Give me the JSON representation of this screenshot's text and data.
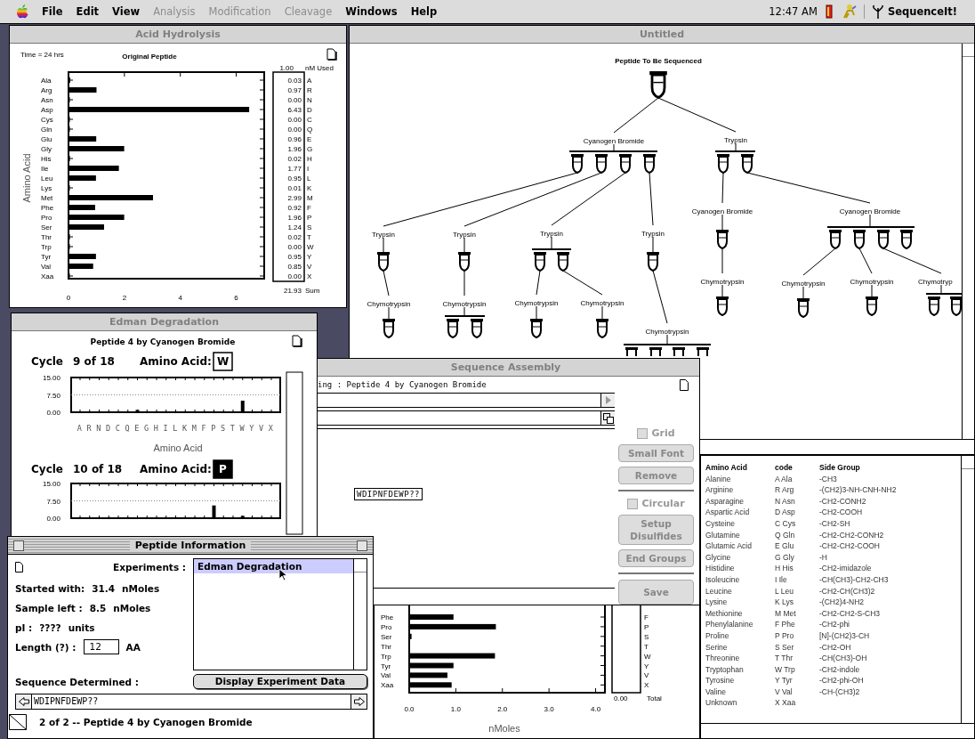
{
  "menu_bar": {
    "items": [
      {
        "label": "File",
        "disabled": false
      },
      {
        "label": "Edit",
        "disabled": false
      },
      {
        "label": "View",
        "disabled": false
      },
      {
        "label": "Analysis",
        "disabled": true
      },
      {
        "label": "Modification",
        "disabled": true
      },
      {
        "label": "Cleavage",
        "disabled": true
      },
      {
        "label": "Windows",
        "disabled": false
      },
      {
        "label": "Help",
        "disabled": false
      }
    ],
    "clock": "12:47 AM",
    "app": "SequenceIt!"
  },
  "acid_hydrolysis": {
    "title": "Acid Hydrolysis",
    "time": "Time = 24 hrs",
    "used_amount": "1.00",
    "used_label": "nM Used",
    "amounts": [
      {
        "value": "0.03",
        "code": "A"
      },
      {
        "value": "0.97",
        "code": "R"
      },
      {
        "value": "0.00",
        "code": "N"
      },
      {
        "value": "6.43",
        "code": "D"
      },
      {
        "value": "0.00",
        "code": "C"
      },
      {
        "value": "0.00",
        "code": "Q"
      },
      {
        "value": "0.96",
        "code": "E"
      },
      {
        "value": "1.96",
        "code": "G"
      },
      {
        "value": "0.02",
        "code": "H"
      },
      {
        "value": "1.77",
        "code": "I"
      },
      {
        "value": "0.95",
        "code": "L"
      },
      {
        "value": "0.01",
        "code": "K"
      },
      {
        "value": "2.99",
        "code": "M"
      },
      {
        "value": "0.92",
        "code": "F"
      },
      {
        "value": "1.96",
        "code": "P"
      },
      {
        "value": "1.24",
        "code": "S"
      },
      {
        "value": "0.02",
        "code": "T"
      },
      {
        "value": "0.00",
        "code": "W"
      },
      {
        "value": "0.95",
        "code": "Y"
      },
      {
        "value": "0.85",
        "code": "V"
      },
      {
        "value": "0.00",
        "code": "X"
      }
    ],
    "total": "21.93",
    "total_label": "Sum",
    "chart_data": {
      "type": "bar",
      "orientation": "horizontal",
      "title": "Original Peptide",
      "ylabel": "Amino Acid",
      "categories": [
        "Ala",
        "Arg",
        "Asn",
        "Asp",
        "Cys",
        "Gln",
        "Glu",
        "Gly",
        "His",
        "Ile",
        "Leu",
        "Lys",
        "Met",
        "Phe",
        "Pro",
        "Ser",
        "Thr",
        "Trp",
        "Tyr",
        "Val",
        "Xaa"
      ],
      "values": [
        0.03,
        0.97,
        0,
        6.43,
        0,
        0,
        0.96,
        1.96,
        0.02,
        1.77,
        0.95,
        0.01,
        2.99,
        0.92,
        1.96,
        1.24,
        0.02,
        0,
        0.95,
        0.85,
        0
      ],
      "xlim": [
        0,
        7
      ],
      "xticks": [
        0,
        2,
        4,
        6
      ]
    }
  },
  "untitled": {
    "title": "Untitled",
    "tree": {
      "label": "Peptide To Be Sequenced",
      "fragments": [
        {
          "kind": "tube",
          "treatments": [
            {
              "label": "Cyanogen Bromide",
              "fragments": [
                {
                  "kind": "tube",
                  "treatments": [
                    {
                      "label": "Trypsin",
                      "fragments": [
                        {
                          "kind": "tube",
                          "treatments": [
                            {
                              "label": "Chymotrypsin",
                              "fragments": [
                                {
                                  "kind": "tube"
                                }
                              ]
                            }
                          ]
                        }
                      ]
                    }
                  ]
                },
                {
                  "kind": "tube",
                  "treatments": [
                    {
                      "label": "Trypsin",
                      "fragments": [
                        {
                          "kind": "tube",
                          "treatments": [
                            {
                              "label": "Chymotrypsin",
                              "fragments": [
                                {
                                  "kind": "tube"
                                },
                                {
                                  "kind": "tube"
                                }
                              ]
                            }
                          ]
                        }
                      ]
                    }
                  ]
                },
                {
                  "kind": "tube",
                  "treatments": [
                    {
                      "label": "Trypsin",
                      "fragments": [
                        {
                          "kind": "tube",
                          "treatments": [
                            {
                              "label": "Chymotrypsin",
                              "fragments": [
                                {
                                  "kind": "tube"
                                }
                              ]
                            }
                          ]
                        },
                        {
                          "kind": "tube",
                          "treatments": [
                            {
                              "label": "Chymotrypsin",
                              "fragments": [
                                {
                                  "kind": "tube"
                                }
                              ]
                            }
                          ]
                        }
                      ]
                    }
                  ]
                },
                {
                  "kind": "tube",
                  "treatments": [
                    {
                      "label": "Trypsin",
                      "fragments": [
                        {
                          "kind": "tube",
                          "treatments": [
                            {
                              "label": "Chymotrypsin",
                              "fragments": [
                                {
                                  "kind": "tube"
                                },
                                {
                                  "kind": "tube"
                                },
                                {
                                  "kind": "tube"
                                },
                                {
                                  "kind": "tube"
                                }
                              ]
                            }
                          ]
                        }
                      ]
                    }
                  ]
                }
              ]
            },
            {
              "label": "Trypsin",
              "fragments": [
                {
                  "kind": "tube",
                  "treatments": [
                    {
                      "label": "Cyanogen Bromide",
                      "fragments": [
                        {
                          "kind": "tube",
                          "treatments": [
                            {
                              "label": "Chymotrypsin",
                              "fragments": [
                                {
                                  "kind": "tube"
                                }
                              ]
                            }
                          ]
                        }
                      ]
                    }
                  ]
                },
                {
                  "kind": "tube",
                  "treatments": [
                    {
                      "label": "Cyanogen Bromide",
                      "fragments": [
                        {
                          "kind": "tube",
                          "treatments": [
                            {
                              "label": "Chymotrypsin",
                              "fragments": [
                                {
                                  "kind": "tube"
                                }
                              ]
                            }
                          ]
                        },
                        {
                          "kind": "tube",
                          "treatments": [
                            {
                              "label": "Chymotrypsin",
                              "fragments": [
                                {
                                  "kind": "tube"
                                }
                              ]
                            }
                          ]
                        },
                        {
                          "kind": "tube",
                          "treatments": [
                            {
                              "label": "Chymotryp",
                              "fragments": [
                                {
                                  "kind": "tube"
                                },
                                {
                                  "kind": "tube"
                                }
                              ]
                            }
                          ]
                        },
                        {
                          "kind": "tube"
                        }
                      ]
                    }
                  ]
                }
              ]
            }
          ]
        }
      ]
    }
  },
  "amino_acid_table": {
    "columns": [
      "Amino Acid",
      "code",
      "Side Group"
    ],
    "rows": [
      [
        "Alanine",
        "A Ala",
        "-CH3"
      ],
      [
        "Arginine",
        "R Arg",
        "-(CH2)3-NH-CNH-NH2"
      ],
      [
        "Asparagine",
        "N Asn",
        "-CH2-CONH2"
      ],
      [
        "Aspartic Acid",
        "D Asp",
        "-CH2-COOH"
      ],
      [
        "Cysteine",
        "C Cys",
        "-CH2-SH"
      ],
      [
        "Glutamine",
        "Q Gln",
        "-CH2-CH2-CONH2"
      ],
      [
        "Glutamic Acid",
        "E Glu",
        "-CH2-CH2-COOH"
      ],
      [
        "Glycine",
        "G Gly",
        "-H"
      ],
      [
        "Histidine",
        "H His",
        "-CH2-imidazole"
      ],
      [
        "Isoleucine",
        "I Ile",
        "-CH(CH3)-CH2-CH3"
      ],
      [
        "Leucine",
        "L Leu",
        "-CH2-CH(CH3)2"
      ],
      [
        "Lysine",
        "K Lys",
        "-(CH2)4-NH2"
      ],
      [
        "Methionine",
        "M Met",
        "-CH2-CH2-S-CH3"
      ],
      [
        "Phenylalanine",
        "F Phe",
        "-CH2-phi"
      ],
      [
        "Proline",
        "P Pro",
        "[N]-(CH2)3-CH"
      ],
      [
        "Serine",
        "S Ser",
        "-CH2-OH"
      ],
      [
        "Threonine",
        "T Thr",
        "-CH(CH3)-OH"
      ],
      [
        "Tryptophan",
        "W Trp",
        "-CH2-indole"
      ],
      [
        "Tyrosine",
        "Y Tyr",
        "-CH2-phi-OH"
      ],
      [
        "Valine",
        "V Val",
        "-CH-(CH3)2"
      ],
      [
        "Unknown",
        "X Xaa"
      ]
    ]
  },
  "nmoles_chart": {
    "codes": [
      "F",
      "P",
      "S",
      "T",
      "W",
      "Y",
      "V",
      "X"
    ],
    "total": "0.00",
    "total_label": "Total",
    "chart_data": {
      "type": "bar",
      "orientation": "horizontal",
      "xlabel": "nMoles",
      "categories": [
        "Phe",
        "Pro",
        "Ser",
        "Thr",
        "Trp",
        "Tyr",
        "Val",
        "Xaa"
      ],
      "values": [
        0.95,
        1.86,
        0.05,
        0,
        1.84,
        0.95,
        0.82,
        0.91
      ],
      "xlim": [
        0,
        4.2
      ],
      "xticks": [
        {
          "value": 0,
          "label": "0.0"
        },
        {
          "value": 1,
          "label": "1.0"
        },
        {
          "value": 2,
          "label": "2.0"
        },
        {
          "value": 3,
          "label": "3.0"
        },
        {
          "value": 4,
          "label": "4.0"
        }
      ]
    }
  },
  "sequence_assembly": {
    "title": "Sequence Assembly",
    "header": "ing : Peptide 4 by Cyanogen Bromide",
    "fragment": "WDIPNFDEWP??",
    "controls": [
      {
        "kind": "checkbox",
        "label": "Grid",
        "checked": false
      },
      {
        "kind": "button",
        "label": "Small Font"
      },
      {
        "kind": "button",
        "label": "Remove"
      },
      {
        "kind": "divider"
      },
      {
        "kind": "checkbox",
        "label": "Circular",
        "checked": false
      },
      {
        "kind": "button",
        "label": "Setup Disulfides"
      },
      {
        "kind": "button",
        "label": "End Groups"
      },
      {
        "kind": "divider"
      },
      {
        "kind": "button",
        "label": "Save"
      }
    ]
  },
  "edman_degradation": {
    "title": "Edman Degradation",
    "subtitle": "Peptide 4 by Cyanogen Bromide",
    "xlabel": "Amino Acid",
    "cycles": [
      {
        "label": "Cycle",
        "position": "9 of 18",
        "amino_label": "Amino Acid:",
        "amino": "W",
        "highlighted": false,
        "chart_data": {
          "type": "bar",
          "categories": [
            "A",
            "R",
            "N",
            "D",
            "C",
            "Q",
            "E",
            "G",
            "H",
            "I",
            "L",
            "K",
            "M",
            "F",
            "P",
            "S",
            "T",
            "W",
            "Y",
            "V",
            "X"
          ],
          "values": [
            0,
            0,
            0,
            0,
            0,
            0,
            1.0,
            0,
            0,
            0,
            0,
            0,
            0,
            0,
            0,
            0,
            0,
            5.0,
            0,
            0,
            0
          ],
          "ylim": [
            0,
            15
          ],
          "yticks": [
            {
              "value": 0,
              "label": "0.00"
            },
            {
              "value": 7.5,
              "label": "7.50"
            },
            {
              "value": 15,
              "label": "15.00"
            }
          ]
        }
      },
      {
        "label": "Cycle",
        "position": "10 of 18",
        "amino_label": "Amino Acid:",
        "amino": "P",
        "highlighted": true,
        "chart_data": {
          "type": "bar",
          "values": [
            0,
            0,
            0,
            0,
            0,
            0,
            0,
            0,
            0,
            0,
            0,
            0,
            0,
            0,
            5.5,
            0,
            0,
            1.0,
            0,
            0,
            0
          ],
          "ylim": [
            0,
            15
          ],
          "yticks": [
            {
              "value": 0,
              "label": "0.00"
            },
            {
              "value": 7.5,
              "label": "7.50"
            },
            {
              "value": 15,
              "label": "15.00"
            }
          ]
        }
      }
    ]
  },
  "peptide_information": {
    "title": "Peptide Information",
    "experiments_label": "Experiments :",
    "experiments": [
      {
        "label": "Edman Degradation",
        "selected": true
      }
    ],
    "started_label": "Started with:",
    "started_value": "31.4",
    "started_unit": "nMoles",
    "left_label": "Sample left :",
    "left_value": "8.5",
    "left_unit": "nMoles",
    "pi_label": "pI :",
    "pi_value": "????",
    "pi_unit": "units",
    "length_label": "Length (?) :",
    "length_value": "12",
    "length_unit": "AA",
    "sequence_label": "Sequence Determined :",
    "display_button": "Display Experiment Data",
    "sequence_value": "WDIPNFDEWP??",
    "status": "2 of 2 -- Peptide 4 by Cyanogen Bromide"
  }
}
